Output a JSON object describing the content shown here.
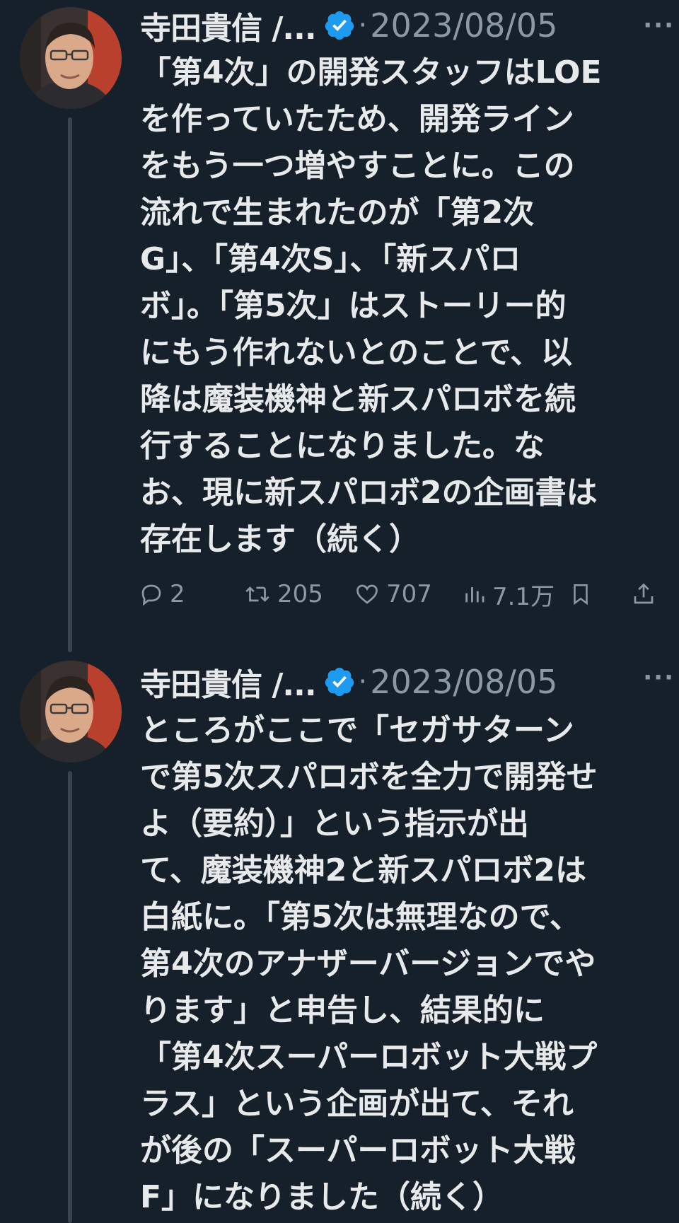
{
  "colors": {
    "background": "#15202b",
    "text": "#e7e9ea",
    "secondary": "#8b98a5",
    "verified": "#1d9bf0",
    "thread_line": "#38444d"
  },
  "tweets": [
    {
      "author": "寺田貴信 /...",
      "separator": "·",
      "date": "2023/08/05",
      "more": "···",
      "text": "「第4次」の開発スタッフはLOE\nを作っていたため、開発ライン\nをもう一つ増やすことに。この\n流れで生まれたのが「第2次\nG」、「第4次S」、「新スパロ\nボ」。「第5次」はストーリー的\nにもう作れないとのことで、以\n降は魔装機神と新スパロボを続\n行することになりました。な\nお、現に新スパロボ2の企画書は\n存在します（続く）",
      "stats": {
        "replies": "2",
        "retweets": "205",
        "likes": "707",
        "views": "7.1万"
      },
      "icons": [
        "reply-icon",
        "retweet-icon",
        "like-icon",
        "views-icon",
        "bookmark-icon",
        "share-icon"
      ]
    },
    {
      "author": "寺田貴信 /...",
      "separator": "·",
      "date": "2023/08/05",
      "more": "···",
      "text": "ところがここで「セガサターン\nで第5次スパロボを全力で開発せ\nよ（要約）」という指示が出\nて、魔装機神2と新スパロボ2は\n白紙に。「第5次は無理なので、\n第4次のアナザーバージョンでや\nります」と申告し、結果的に\n「第4次スーパーロボット大戦プ\nラス」という企画が出て、それ\nが後の「スーパーロボット大戦\nF」になりました（続く）"
    }
  ]
}
